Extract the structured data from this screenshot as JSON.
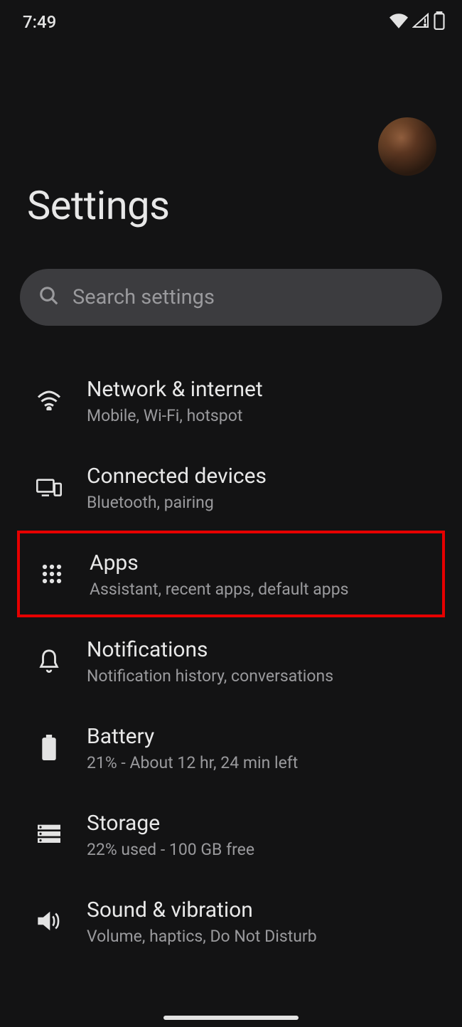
{
  "status": {
    "time": "7:49"
  },
  "header": {
    "title": "Settings"
  },
  "search": {
    "placeholder": "Search settings"
  },
  "items": [
    {
      "title": "Network & internet",
      "subtitle": "Mobile, Wi-Fi, hotspot",
      "icon": "wifi-icon",
      "highlighted": false
    },
    {
      "title": "Connected devices",
      "subtitle": "Bluetooth, pairing",
      "icon": "devices-icon",
      "highlighted": false
    },
    {
      "title": "Apps",
      "subtitle": "Assistant, recent apps, default apps",
      "icon": "apps-icon",
      "highlighted": true
    },
    {
      "title": "Notifications",
      "subtitle": "Notification history, conversations",
      "icon": "notifications-icon",
      "highlighted": false
    },
    {
      "title": "Battery",
      "subtitle": "21% - About 12 hr, 24 min left",
      "icon": "battery-icon",
      "highlighted": false
    },
    {
      "title": "Storage",
      "subtitle": "22% used - 100 GB free",
      "icon": "storage-icon",
      "highlighted": false
    },
    {
      "title": "Sound & vibration",
      "subtitle": "Volume, haptics, Do Not Disturb",
      "icon": "sound-icon",
      "highlighted": false
    }
  ]
}
